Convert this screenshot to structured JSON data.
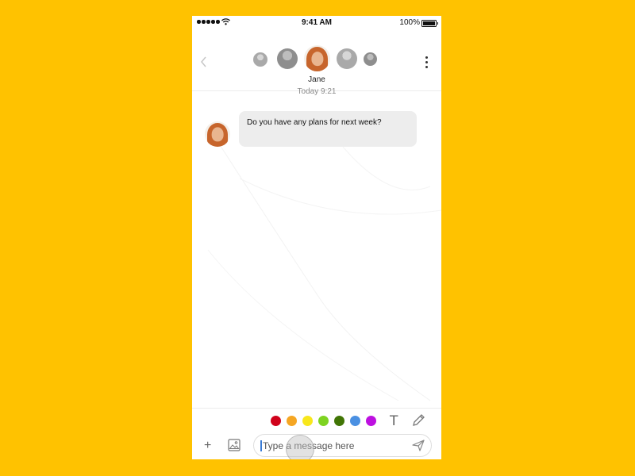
{
  "status_bar": {
    "time": "9:41 AM",
    "battery": "100%"
  },
  "header": {
    "back_icon": "chevron-left-icon",
    "menu_icon": "more-vertical-icon",
    "active_contact": "Jane"
  },
  "conversation": {
    "timestamp": "Today 9:21",
    "messages": [
      {
        "sender": "Jane",
        "text": "Do you have any plans for next week?"
      }
    ]
  },
  "toolbar": {
    "colors": [
      "#D0021B",
      "#F5A623",
      "#F8E71C",
      "#7ED321",
      "#417505",
      "#4A90E2",
      "#BD10E0"
    ],
    "text_tool_label": "T",
    "plus_label": "+"
  },
  "composer": {
    "placeholder": "Type a message here",
    "visible_text": "Type a message here"
  }
}
